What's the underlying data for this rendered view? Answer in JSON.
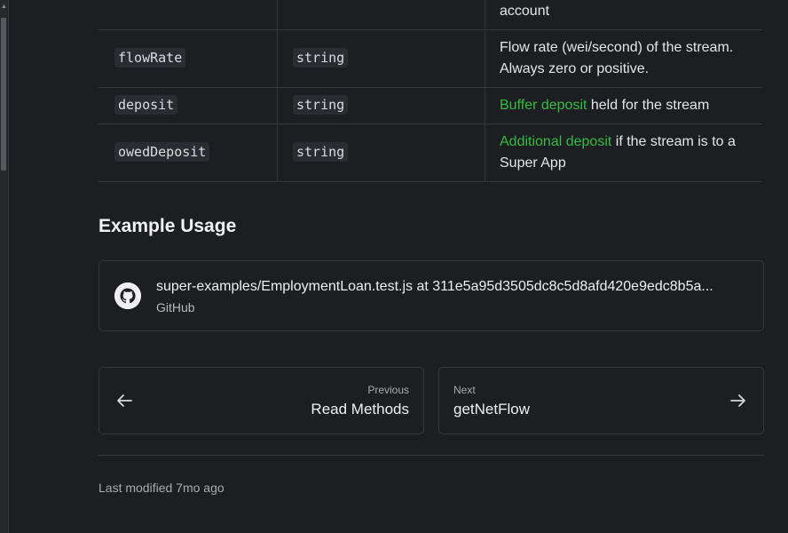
{
  "table": {
    "rows": [
      {
        "name": "",
        "type": "",
        "desc_link": "",
        "desc_text": "account"
      },
      {
        "name": "flowRate",
        "type": "string",
        "desc_link": "",
        "desc_text": "Flow rate (wei/second) of the stream. Always zero or positive."
      },
      {
        "name": "deposit",
        "type": "string",
        "desc_link": "Buffer deposit",
        "desc_text": " held for the stream"
      },
      {
        "name": "owedDeposit",
        "type": "string",
        "desc_link": "Additional deposit",
        "desc_text": " if the stream is to a Super App"
      }
    ]
  },
  "example": {
    "heading": "Example Usage",
    "embed_title": "super-examples/EmploymentLoan.test.js at 311e5a95d3505dc8c5d8afd420e9edc8b5a...",
    "embed_source": "GitHub",
    "embed_icon": "github-icon"
  },
  "pagination": {
    "prev_label": "Previous",
    "prev_title": "Read Methods",
    "next_label": "Next",
    "next_title": "getNetFlow"
  },
  "footer": {
    "last_modified": "Last modified 7mo ago"
  },
  "colors": {
    "link": "#2fbf3f",
    "background": "#1c1e22"
  }
}
